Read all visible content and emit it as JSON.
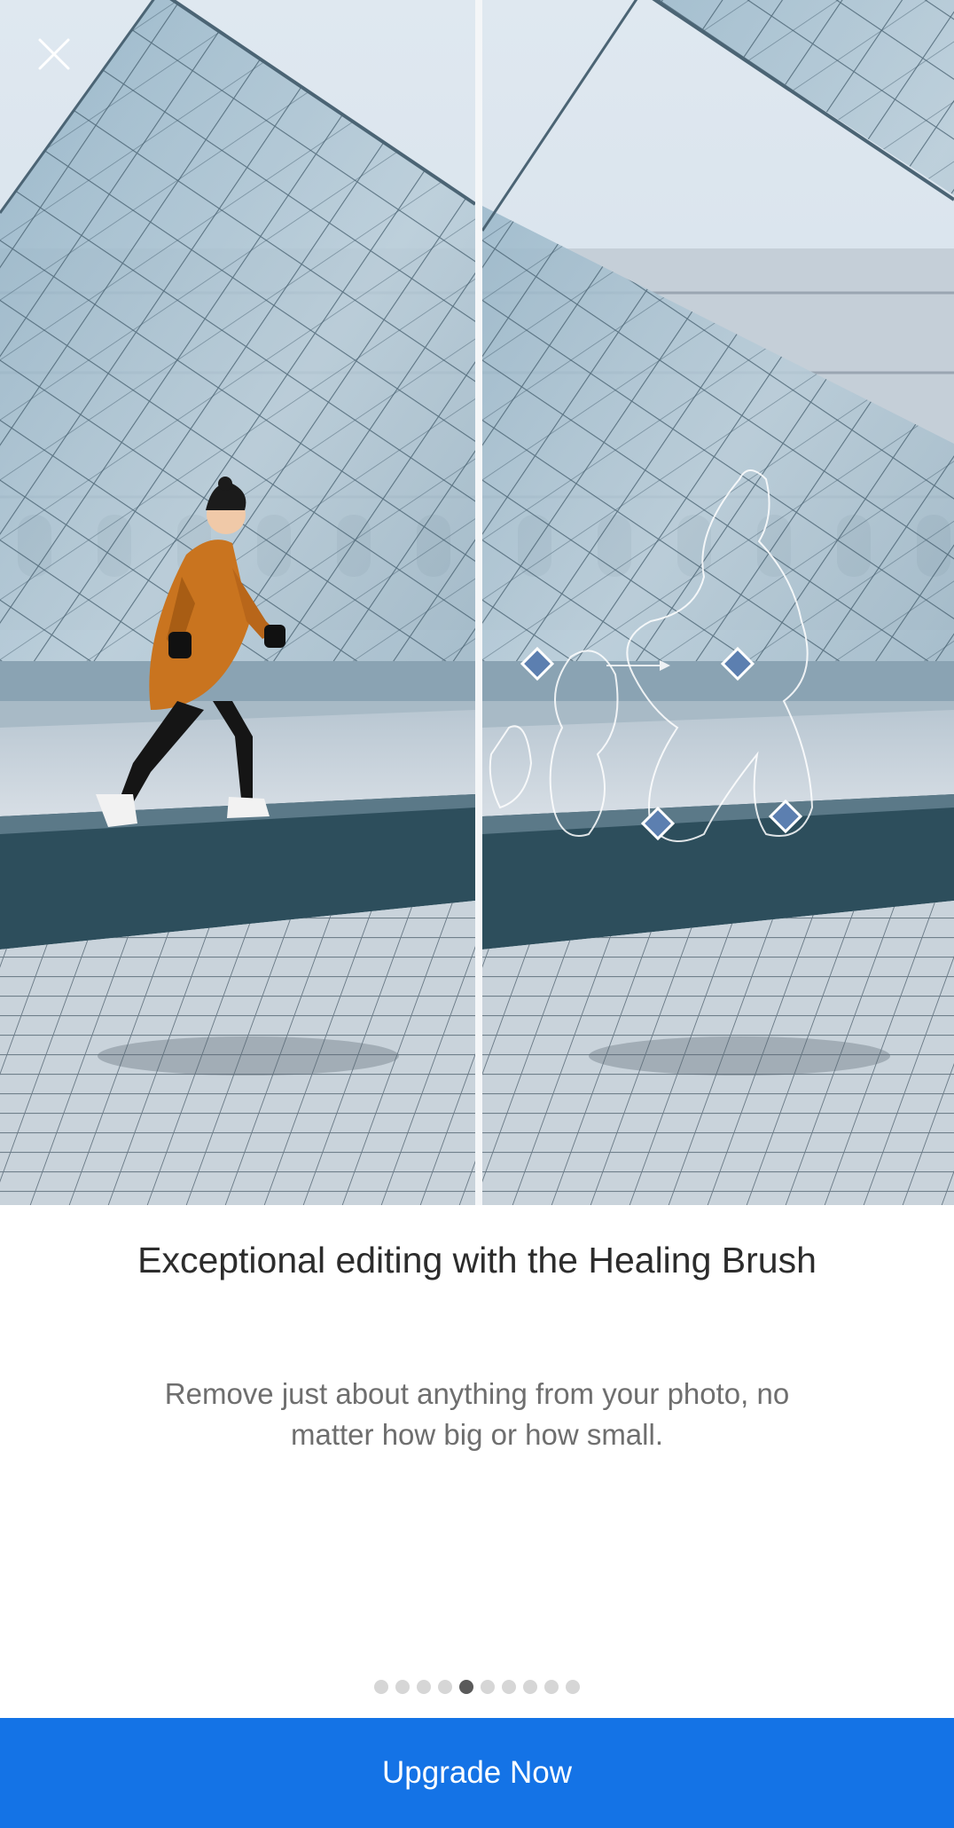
{
  "hero": {
    "before_label": "",
    "after_label": ""
  },
  "close_icon": "close-icon",
  "title": "Exceptional editing with the Healing Brush",
  "subtitle": "Remove just about anything from your photo, no matter how big or how small.",
  "pager": {
    "total": 10,
    "active_index": 4
  },
  "cta": {
    "label": "Upgrade Now"
  },
  "colors": {
    "accent": "#1473e6",
    "dot_active": "#5a5a5a",
    "dot_inactive": "#d6d6d6",
    "title_text": "#2c2c2c",
    "body_text": "#6e6e6e"
  }
}
